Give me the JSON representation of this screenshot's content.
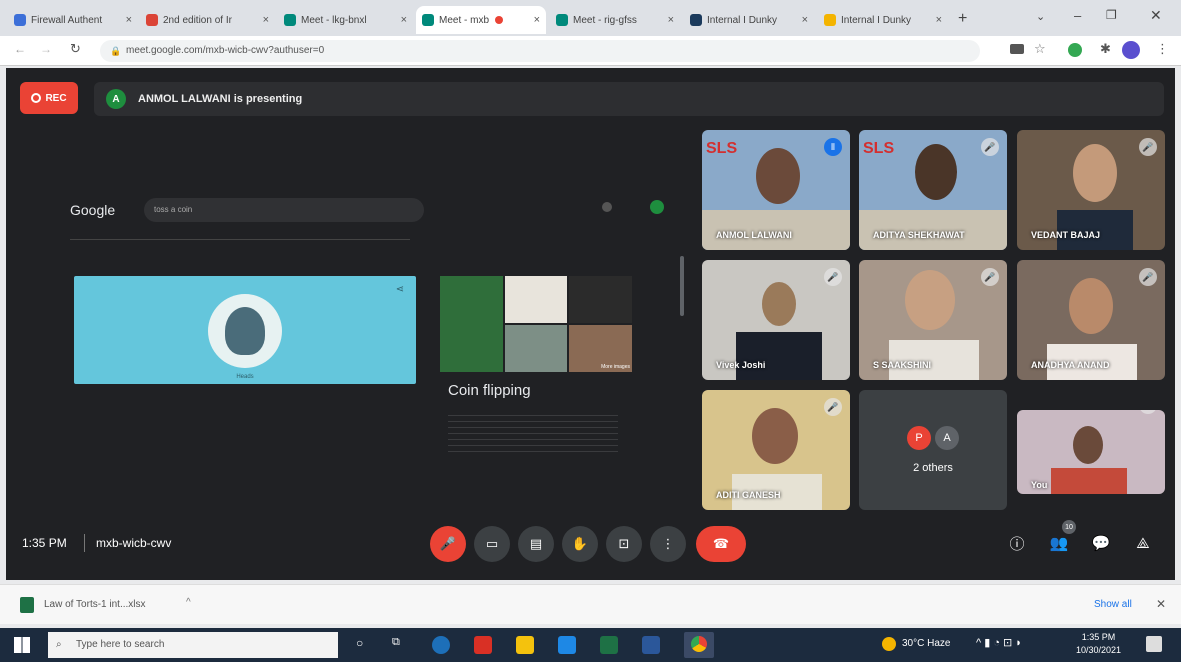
{
  "browser": {
    "tabs": [
      {
        "title": "Firewall Authent",
        "favicon": "#3c6fd8"
      },
      {
        "title": "2nd edition of Ir",
        "favicon": "#db4437"
      },
      {
        "title": "Meet - lkg-bnxl",
        "favicon": "#00897b"
      },
      {
        "title": "Meet - mxb",
        "favicon": "#00897b"
      },
      {
        "title": "Meet - rig-gfss",
        "favicon": "#00897b"
      },
      {
        "title": "Internal I Dunky",
        "favicon": "#1b3a5c"
      },
      {
        "title": "Internal I Dunky",
        "favicon": "#f4b400"
      }
    ],
    "url": "meet.google.com/mxb-wicb-cwv?authuser=0"
  },
  "meet": {
    "rec_label": "REC",
    "presenter_initial": "A",
    "presenting_text": "ANMOL LALWANI is presenting",
    "shared": {
      "logo": "Google",
      "search_query": "toss a coin",
      "card_title": "Coin flipping",
      "image_caption": "Heads",
      "more_images": "More images"
    },
    "participants": [
      {
        "name": "ANMOL LALWANI",
        "bg": "#8aa9c9"
      },
      {
        "name": "ADITYA SHEKHAWAT",
        "bg": "#8aa9c9"
      },
      {
        "name": "VEDANT BAJAJ",
        "bg": "#6b5a4a"
      },
      {
        "name": "Vivek Joshi",
        "bg": "#c9c7c2"
      },
      {
        "name": "S SAAKSHINI",
        "bg": "#a7978a"
      },
      {
        "name": "ANADHYA ANAND",
        "bg": "#7a6a5f"
      },
      {
        "name": "ADITI GANESH",
        "bg": "#d8c48c"
      },
      {
        "name": "2 others",
        "bg": "#3c4043"
      },
      {
        "name": "You",
        "bg": "#c9b9c2"
      }
    ],
    "others_initials": [
      "P",
      "A"
    ],
    "time": "1:35 PM",
    "meeting_code": "mxb-wicb-cwv",
    "people_count": "10"
  },
  "download": {
    "file": "Law of Torts-1 int...xlsx",
    "show_all": "Show all"
  },
  "taskbar": {
    "search_placeholder": "Type here to search",
    "weather": "30°C Haze",
    "time": "1:35 PM",
    "date": "10/30/2021"
  }
}
